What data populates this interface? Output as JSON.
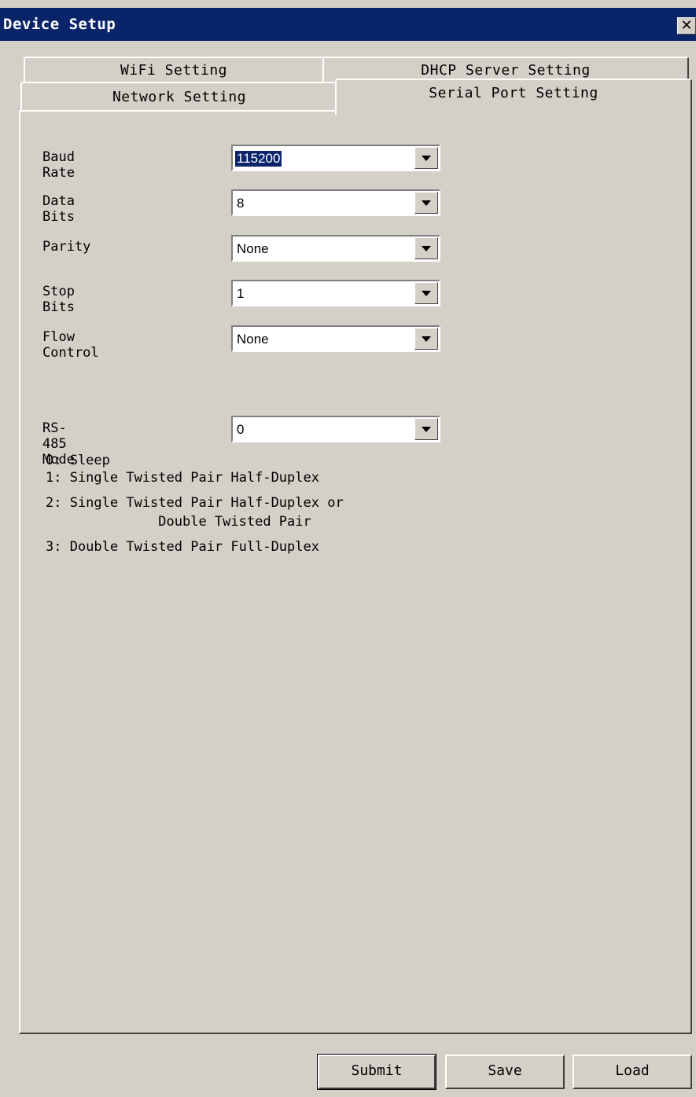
{
  "window": {
    "title": "Device Setup",
    "close_glyph": "✕"
  },
  "tabs": {
    "wifi": "WiFi Setting",
    "dhcp": "DHCP Server Setting",
    "network": "Network Setting",
    "serial": "Serial Port Setting"
  },
  "fields": {
    "baud_rate": {
      "label": "Baud Rate",
      "value": "115200"
    },
    "data_bits": {
      "label": "Data Bits",
      "value": "8"
    },
    "parity": {
      "label": "Parity",
      "value": "None"
    },
    "stop_bits": {
      "label": "Stop Bits",
      "value": "1"
    },
    "flow_control": {
      "label": "Flow Control",
      "value": "None"
    },
    "rs485_mode": {
      "label": "RS-485 Mode",
      "value": "0"
    }
  },
  "rs485_modes": [
    "0: Sleep",
    "1: Single Twisted Pair Half-Duplex",
    "2: Single Twisted Pair Half-Duplex or",
    "              Double Twisted Pair",
    "3: Double Twisted Pair Full-Duplex"
  ],
  "buttons": {
    "submit": "Submit",
    "save": "Save",
    "load": "Load"
  },
  "icons": {
    "close": "close-icon",
    "dropdown": "chevron-down-icon"
  },
  "colors": {
    "titlebar": "#0a246a",
    "face": "#d4d0c8",
    "selection": "#0a246a"
  }
}
